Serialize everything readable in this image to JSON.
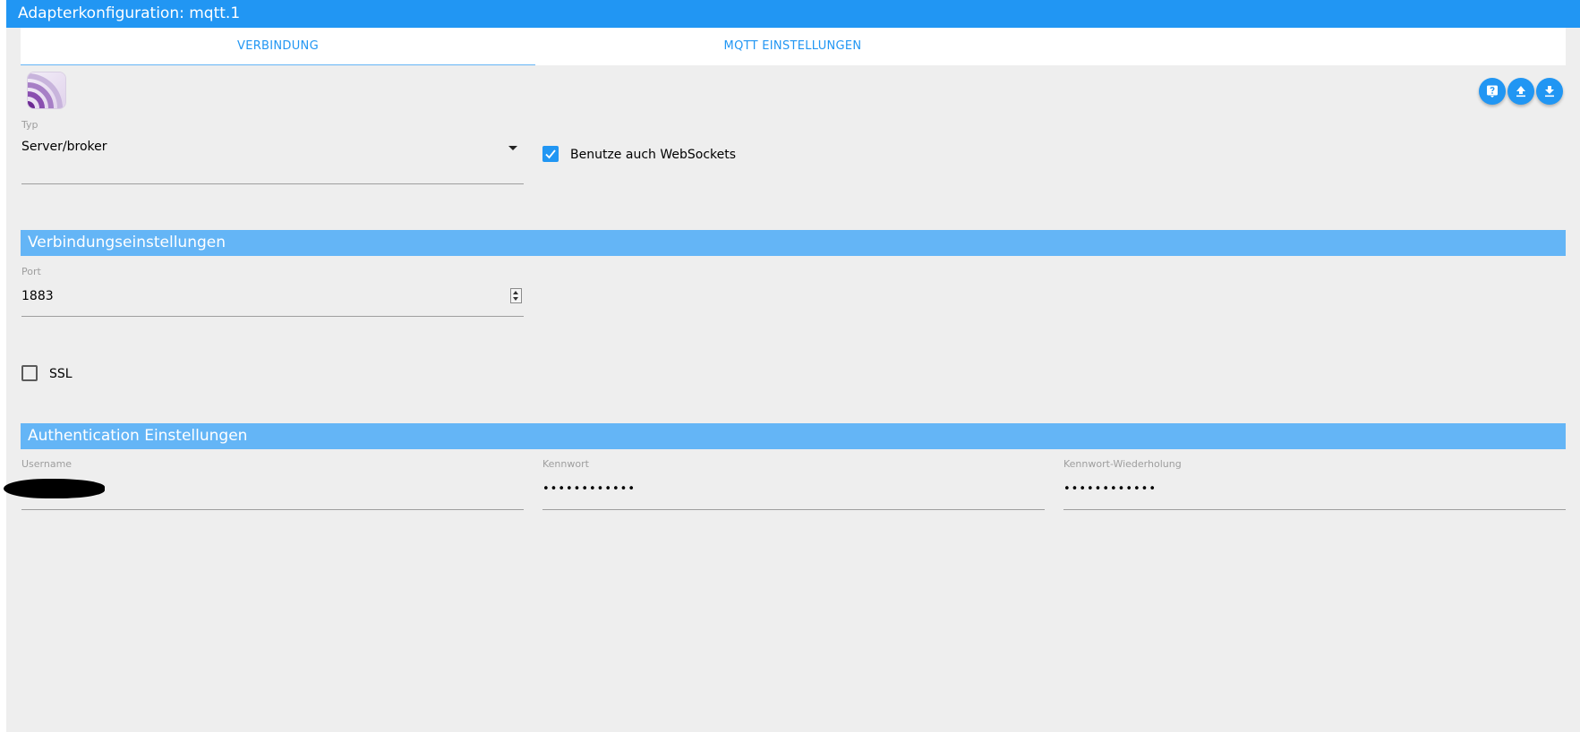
{
  "window": {
    "title": "Adapterkonfiguration: mqtt.1"
  },
  "tabs": [
    {
      "label": "VERBINDUNG",
      "active": true
    },
    {
      "label": "MQTT EINSTELLUNGEN",
      "active": false
    }
  ],
  "colors": {
    "primary": "#2196f3",
    "section": "#64b5f6",
    "background": "#eeeeee"
  },
  "header_buttons": [
    {
      "icon": "help-icon"
    },
    {
      "icon": "upload-icon"
    },
    {
      "icon": "download-icon"
    }
  ],
  "typ": {
    "label": "Typ",
    "value": "Server/broker"
  },
  "websockets": {
    "label": "Benutze auch WebSockets",
    "checked": true
  },
  "sections": {
    "connection": "Verbindungseinstellungen",
    "auth": "Authentication Einstellungen"
  },
  "port": {
    "label": "Port",
    "value": "1883"
  },
  "ssl": {
    "label": "SSL",
    "checked": false
  },
  "auth": {
    "username_label": "Username",
    "password_label": "Kennwort",
    "password_value": "••••••••••••",
    "password_repeat_label": "Kennwort-Wiederholung",
    "password_repeat_value": "••••••••••••"
  }
}
